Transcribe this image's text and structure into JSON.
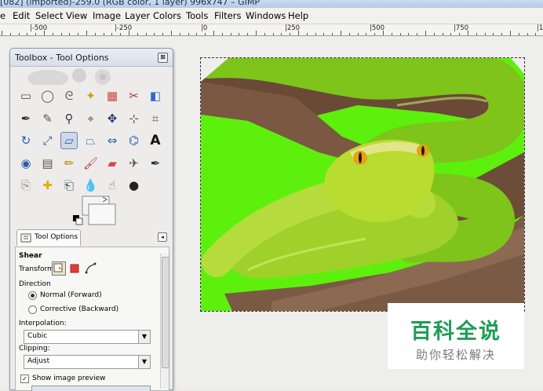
{
  "window": {
    "title": "[082] (imported)-259.0 (RGB color, 1 layer) 996x747 – GIMP"
  },
  "menubar": {
    "items": [
      "e",
      "Edit",
      "Select",
      "View",
      "Image",
      "Layer",
      "Colors",
      "Tools",
      "Filters",
      "Windows",
      "Help"
    ]
  },
  "ruler": {
    "labels": [
      "|-500",
      "|-250",
      "|0",
      "|250",
      "|500",
      "|750",
      "|1000"
    ]
  },
  "toolbox": {
    "title": "Toolbox - Tool Options",
    "close_glyph": "⊠",
    "tools": [
      "rect-select",
      "ellipse-select",
      "free-select",
      "fuzzy-select",
      "select-by-color",
      "scissors-select",
      "foreground-select",
      "paths",
      "color-picker",
      "zoom",
      "measure",
      "move",
      "align",
      "crop",
      "rotate",
      "scale",
      "shear",
      "perspective",
      "flip",
      "cage-transform",
      "text",
      "bucket-fill",
      "blend",
      "pencil",
      "paintbrush",
      "eraser",
      "airbrush",
      "ink",
      "clone",
      "heal",
      "perspective-clone",
      "blur-sharpen",
      "smudge",
      "dodge-burn"
    ],
    "selected_tool": "shear"
  },
  "tool_options": {
    "tab_label": "Tool Options",
    "tool_name": "Shear",
    "transform_label": "Transform:",
    "direction_label": "Direction",
    "direction_options": [
      "Normal (Forward)",
      "Corrective (Backward)"
    ],
    "direction_selected": "Normal (Forward)",
    "interpolation_label": "Interpolation:",
    "interpolation_value": "Cubic",
    "clipping_label": "Clipping:",
    "clipping_value": "Adjust",
    "preview_label": "Show image preview",
    "preview_checked": true
  },
  "watermark": {
    "title": "百科全说",
    "subtitle": "助你轻松解决"
  },
  "colors": {
    "background_green": "#5df00d",
    "watermark_green": "#1e9e56"
  }
}
